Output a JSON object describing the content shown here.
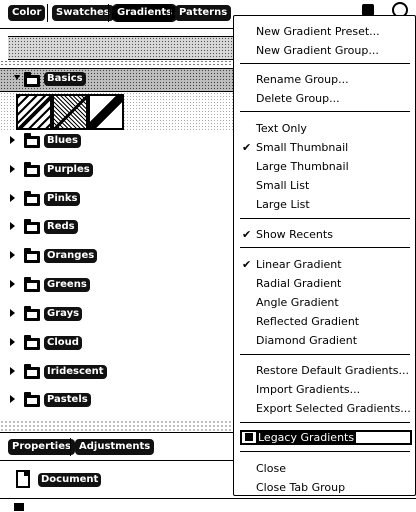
{
  "panel": {
    "tabs": [
      "Color",
      "Swatches",
      "Gradients",
      "Patterns"
    ],
    "active_tab": "Gradients",
    "expanded_group": "Basics",
    "groups": [
      "Blues",
      "Purples",
      "Pinks",
      "Reds",
      "Oranges",
      "Greens",
      "Grays",
      "Cloud",
      "Iridescent",
      "Pastels"
    ]
  },
  "lower_panel": {
    "tabs": [
      "Properties",
      "Adjustments"
    ],
    "document_label": "Document"
  },
  "menu": {
    "items": {
      "new_gradient_preset": "New Gradient Preset...",
      "new_gradient_group": "New Gradient Group...",
      "rename_group": "Rename Group...",
      "delete_group": "Delete Group...",
      "text_only": "Text Only",
      "small_thumbnail": "Small Thumbnail",
      "large_thumbnail": "Large Thumbnail",
      "small_list": "Small List",
      "large_list": "Large List",
      "show_recents": "Show Recents",
      "linear_gradient": "Linear Gradient",
      "radial_gradient": "Radial Gradient",
      "angle_gradient": "Angle Gradient",
      "reflected_gradient": "Reflected Gradient",
      "diamond_gradient": "Diamond Gradient",
      "restore_default": "Restore Default Gradients...",
      "import_gradients": "Import Gradients...",
      "export_selected": "Export Selected Gradients...",
      "legacy_gradients": "Legacy Gradients",
      "close": "Close",
      "close_tab_group": "Close Tab Group"
    },
    "check_glyph": "✔",
    "checked": [
      "small_thumbnail",
      "show_recents",
      "linear_gradient"
    ]
  },
  "icons": {
    "folder": "folder-icon",
    "chevron_down": "chevron-down-icon",
    "chevron_right": "chevron-right-icon",
    "document": "document-icon",
    "checkmark": "checkmark-icon"
  }
}
